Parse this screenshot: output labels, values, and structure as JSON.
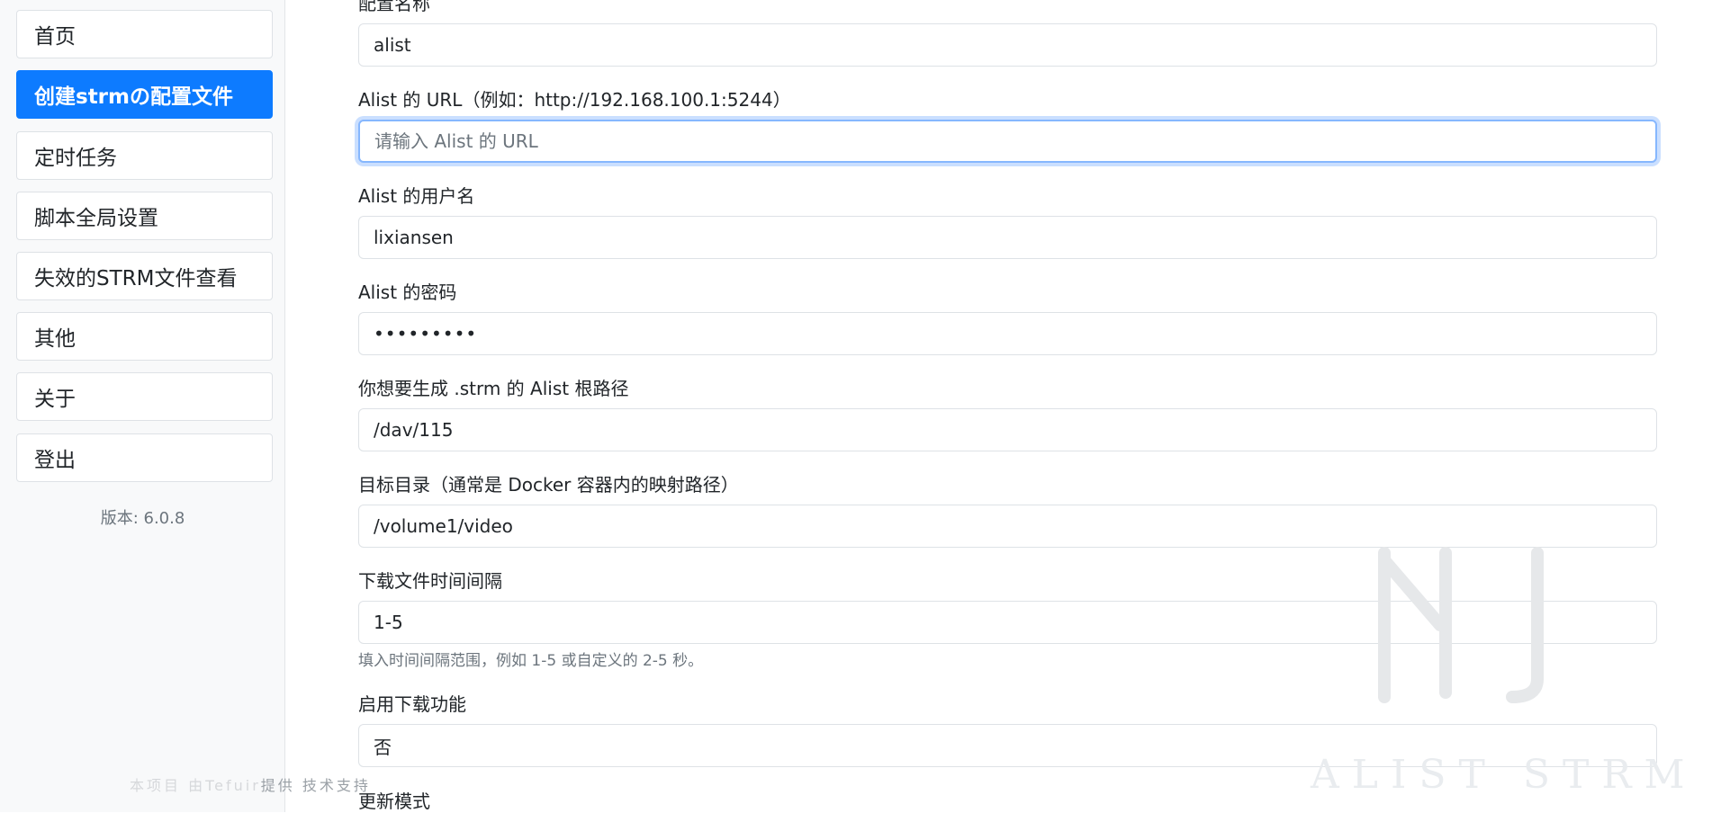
{
  "sidebar": {
    "items": [
      {
        "label": "首页"
      },
      {
        "label": "创建strmの配置文件"
      },
      {
        "label": "定时任务"
      },
      {
        "label": "脚本全局设置"
      },
      {
        "label": "失效的STRM文件查看"
      },
      {
        "label": "其他"
      },
      {
        "label": "关于"
      },
      {
        "label": "登出"
      }
    ],
    "version": "版本: 6.0.8",
    "credit_pre": "本项目 由Tefuir",
    "credit_post": "提供 技术支持"
  },
  "form": {
    "config_name_label": "配置名称",
    "config_name_value": "alist",
    "url_label": "Alist 的 URL（例如：http://192.168.100.1:5244）",
    "url_placeholder": "请输入 Alist 的 URL",
    "username_label": "Alist 的用户名",
    "username_value": "lixiansen",
    "password_label": "Alist 的密码",
    "password_value": "•••••••••",
    "root_label": "你想要生成 .strm 的 Alist 根路径",
    "root_value": "/dav/115",
    "target_label": "目标目录（通常是 Docker 容器内的映射路径）",
    "target_value": "/volume1/video",
    "interval_label": "下载文件时间间隔",
    "interval_value": "1-5",
    "interval_hint": "填入时间间隔范围，例如 1-5 或自定义的 2-5 秒。",
    "download_label": "启用下载功能",
    "download_value": "否",
    "update_mode_label": "更新模式"
  },
  "watermark": {
    "text": "ALIST STRM"
  }
}
